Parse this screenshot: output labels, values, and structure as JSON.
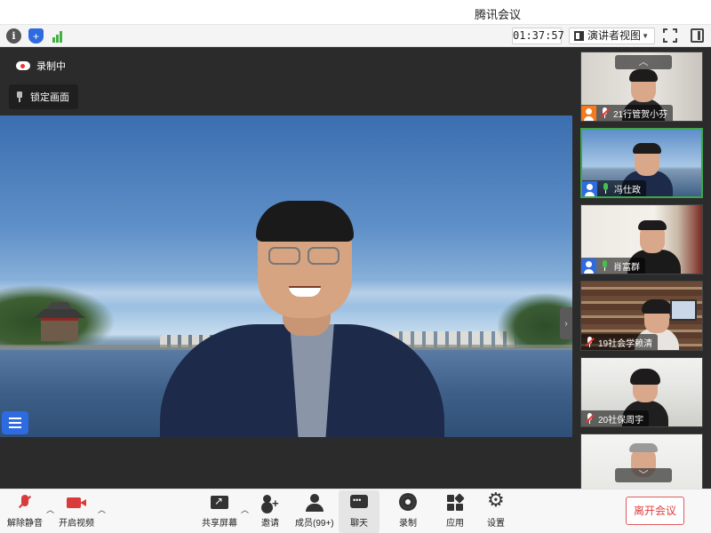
{
  "window": {
    "title": "腾讯会议"
  },
  "toolbar": {
    "timer": "01:37:57",
    "view_mode": "演讲者视图"
  },
  "main": {
    "recording_label": "录制中",
    "lock_view_label": "锁定画面"
  },
  "gallery": {
    "participants": [
      {
        "name": "21行管贺小芬",
        "mic": "muted",
        "avatar_color": "#f27a1f"
      },
      {
        "name": "冯仕政",
        "mic": "active",
        "avatar_color": "#2f6be0",
        "active_speaker": true
      },
      {
        "name": "肖富群",
        "mic": "active",
        "avatar_color": "#2f6be0"
      },
      {
        "name": "19社会学赖清",
        "mic": "muted"
      },
      {
        "name": "20社保周宇",
        "mic": "muted"
      }
    ]
  },
  "controls": {
    "unmute": "解除静音",
    "start_video": "开启视频",
    "share_screen": "共享屏幕",
    "invite": "邀请",
    "members": "成员(99+)",
    "chat": "聊天",
    "record": "录制",
    "apps": "应用",
    "settings": "设置",
    "leave": "离开会议"
  },
  "colors": {
    "accent": "#2f6be0",
    "danger": "#e03c3c",
    "active_border": "#3fa64a"
  }
}
